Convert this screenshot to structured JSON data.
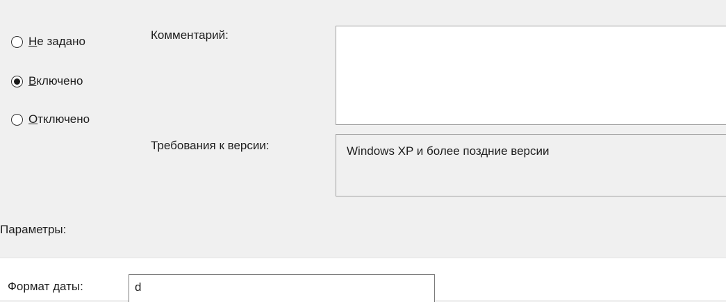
{
  "radio_group": {
    "options": [
      {
        "mnemonic": "Н",
        "rest": "е задано",
        "checked": false
      },
      {
        "mnemonic": "В",
        "rest": "ключено",
        "checked": true
      },
      {
        "mnemonic": "О",
        "rest": "тключено",
        "checked": false
      }
    ]
  },
  "comment": {
    "label": "Комментарий:",
    "value": ""
  },
  "version": {
    "label": "Требования к версии:",
    "value": "Windows XP и более поздние версии"
  },
  "parameters": {
    "label": "Параметры:"
  },
  "date_format": {
    "label": "Формат даты:",
    "value": "d"
  }
}
